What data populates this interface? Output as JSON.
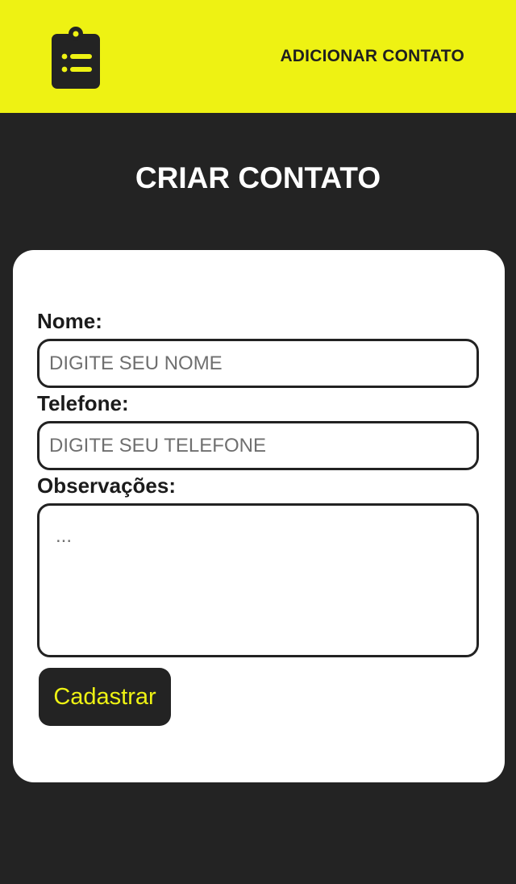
{
  "header": {
    "logo_icon": "clipboard-list-icon",
    "nav_link": "ADICIONAR CONTATO",
    "background": "#eef213"
  },
  "page": {
    "title": "CRIAR CONTATO"
  },
  "form": {
    "name_label": "Nome:",
    "name_placeholder": "DIGITE SEU NOME",
    "name_value": "",
    "phone_label": "Telefone:",
    "phone_placeholder": "DIGITE SEU TELEFONE",
    "phone_value": "",
    "notes_label": "Observações:",
    "notes_placeholder": "...",
    "notes_value": "",
    "submit_label": "Cadastrar"
  },
  "colors": {
    "accent": "#eef213",
    "dark": "#232323",
    "card": "#ffffff"
  }
}
